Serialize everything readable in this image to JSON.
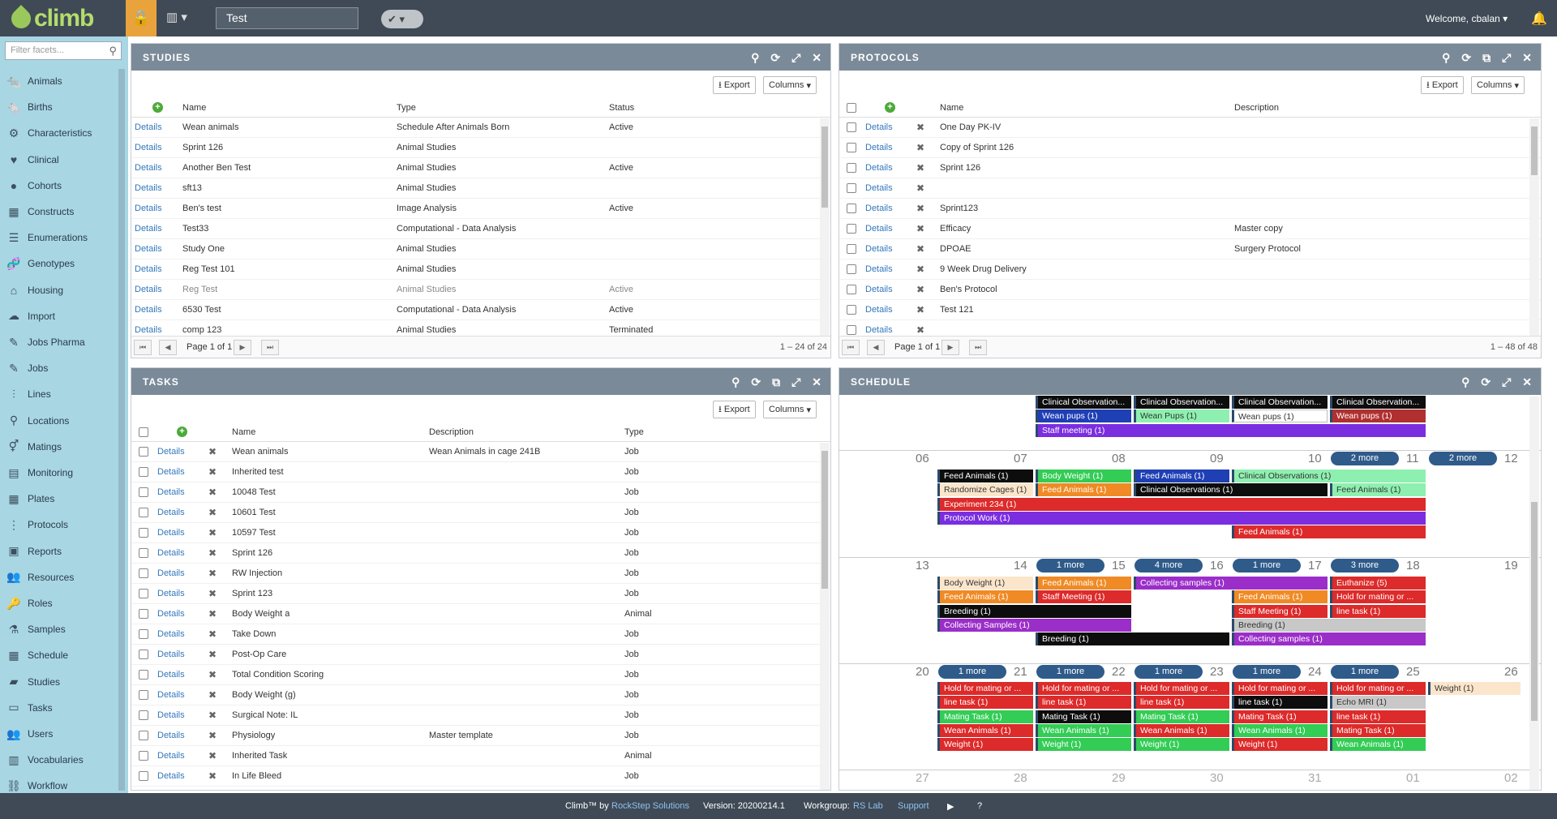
{
  "app": {
    "logo": "climb",
    "workspace_name": "Test",
    "welcome": "Welcome, cbalan"
  },
  "sidebar": {
    "filter_placeholder": "Filter facets...",
    "items": [
      {
        "label": "Animals",
        "icon": "rat-icon"
      },
      {
        "label": "Births",
        "icon": "baby-rat-icon"
      },
      {
        "label": "Characteristics",
        "icon": "cogs-icon"
      },
      {
        "label": "Clinical",
        "icon": "heartbeat-icon"
      },
      {
        "label": "Cohorts",
        "icon": "cohort-icon"
      },
      {
        "label": "Constructs",
        "icon": "grid-icon"
      },
      {
        "label": "Enumerations",
        "icon": "list-icon"
      },
      {
        "label": "Genotypes",
        "icon": "dna-icon"
      },
      {
        "label": "Housing",
        "icon": "home-icon"
      },
      {
        "label": "Import",
        "icon": "cloud-upload-icon"
      },
      {
        "label": "Jobs Pharma",
        "icon": "pipette-icon"
      },
      {
        "label": "Jobs",
        "icon": "pipette-icon"
      },
      {
        "label": "Lines",
        "icon": "lines-icon"
      },
      {
        "label": "Locations",
        "icon": "map-marker-icon"
      },
      {
        "label": "Matings",
        "icon": "mating-icon"
      },
      {
        "label": "Monitoring",
        "icon": "monitor-icon"
      },
      {
        "label": "Plates",
        "icon": "plate-grid-icon"
      },
      {
        "label": "Protocols",
        "icon": "protocol-icon"
      },
      {
        "label": "Reports",
        "icon": "report-icon"
      },
      {
        "label": "Resources",
        "icon": "users-icon"
      },
      {
        "label": "Roles",
        "icon": "key-icon"
      },
      {
        "label": "Samples",
        "icon": "test-tube-icon"
      },
      {
        "label": "Schedule",
        "icon": "calendar-icon"
      },
      {
        "label": "Studies",
        "icon": "book-icon"
      },
      {
        "label": "Tasks",
        "icon": "clipboard-icon"
      },
      {
        "label": "Users",
        "icon": "users-icon"
      },
      {
        "label": "Vocabularies",
        "icon": "library-icon"
      },
      {
        "label": "Workflow",
        "icon": "workflow-icon"
      }
    ]
  },
  "common": {
    "export": "Export",
    "columns": "Columns",
    "details": "Details",
    "page_label": "Page 1 of 1"
  },
  "studies": {
    "title": "STUDIES",
    "headers": {
      "name": "Name",
      "type": "Type",
      "status": "Status"
    },
    "rows": [
      {
        "name": "Wean animals",
        "type": "Schedule After Animals Born",
        "status": "Active"
      },
      {
        "name": "Sprint 126",
        "type": "Animal Studies",
        "status": ""
      },
      {
        "name": "Another Ben Test",
        "type": "Animal Studies",
        "status": "Active"
      },
      {
        "name": "sft13",
        "type": "Animal Studies",
        "status": ""
      },
      {
        "name": "Ben's test",
        "type": "Image Analysis",
        "status": "Active"
      },
      {
        "name": "Test33",
        "type": "Computational - Data Analysis",
        "status": ""
      },
      {
        "name": "Study One",
        "type": "Animal Studies",
        "status": ""
      },
      {
        "name": "Reg Test 101",
        "type": "Animal Studies",
        "status": ""
      },
      {
        "name": "Reg Test",
        "type": "Animal Studies",
        "status": "Active"
      },
      {
        "name": "6530 Test",
        "type": "Computational - Data Analysis",
        "status": "Active"
      },
      {
        "name": "comp 123",
        "type": "Animal Studies",
        "status": "Terminated"
      }
    ],
    "count": "1 – 24 of 24"
  },
  "protocols": {
    "title": "PROTOCOLS",
    "headers": {
      "name": "Name",
      "description": "Description"
    },
    "rows": [
      {
        "name": "One Day PK-IV",
        "description": ""
      },
      {
        "name": "Copy of Sprint 126",
        "description": ""
      },
      {
        "name": "Sprint 126",
        "description": ""
      },
      {
        "name": "",
        "description": ""
      },
      {
        "name": "Sprint123",
        "description": ""
      },
      {
        "name": "Efficacy",
        "description": "Master copy"
      },
      {
        "name": "DPOAE",
        "description": "Surgery Protocol"
      },
      {
        "name": "9 Week Drug Delivery",
        "description": ""
      },
      {
        "name": "Ben's Protocol",
        "description": ""
      },
      {
        "name": "Test 121",
        "description": ""
      },
      {
        "name": "",
        "description": ""
      }
    ],
    "count": "1 – 48 of 48"
  },
  "tasks": {
    "title": "TASKS",
    "headers": {
      "name": "Name",
      "description": "Description",
      "type": "Type"
    },
    "rows": [
      {
        "name": "Wean animals",
        "description": "Wean Animals in cage 241B",
        "type": "Job"
      },
      {
        "name": "Inherited test",
        "description": "",
        "type": "Job"
      },
      {
        "name": "10048 Test",
        "description": "",
        "type": "Job"
      },
      {
        "name": "10601 Test",
        "description": "",
        "type": "Job"
      },
      {
        "name": "10597 Test",
        "description": "",
        "type": "Job"
      },
      {
        "name": "Sprint 126",
        "description": "",
        "type": "Job"
      },
      {
        "name": "RW Injection",
        "description": "",
        "type": "Job"
      },
      {
        "name": "Sprint 123",
        "description": "",
        "type": "Job"
      },
      {
        "name": "Body Weight a",
        "description": "",
        "type": "Animal"
      },
      {
        "name": "Take Down",
        "description": "",
        "type": "Job"
      },
      {
        "name": "Post-Op Care",
        "description": "",
        "type": "Job"
      },
      {
        "name": "Total Condition Scoring",
        "description": "",
        "type": "Job"
      },
      {
        "name": "Body Weight (g)",
        "description": "",
        "type": "Job"
      },
      {
        "name": "Surgical Note: IL",
        "description": "",
        "type": "Job"
      },
      {
        "name": "Physiology",
        "description": "Master template",
        "type": "Job"
      },
      {
        "name": "Inherited Task",
        "description": "",
        "type": "Animal"
      },
      {
        "name": "In Life Bleed",
        "description": "",
        "type": "Job"
      }
    ]
  },
  "schedule": {
    "title": "SCHEDULE",
    "day_numbers": {
      "w2": [
        "06",
        "07",
        "08",
        "09",
        "10",
        "11",
        "12"
      ],
      "w3": [
        "13",
        "14",
        "15",
        "16",
        "17",
        "18",
        "19"
      ],
      "w4": [
        "20",
        "21",
        "22",
        "23",
        "24",
        "25",
        "26"
      ],
      "w5": [
        "27",
        "28",
        "29",
        "30",
        "31",
        "01",
        "02"
      ]
    },
    "more_w2": [
      "2 more",
      "2 more"
    ],
    "more_w3": [
      "1 more",
      "4 more",
      "1 more",
      "3 more"
    ],
    "more_w4": [
      "1 more",
      "1 more",
      "1 more",
      "1 more",
      "1 more"
    ],
    "events": {
      "w1": [
        "Clinical Observation...",
        "Clinical Observation...",
        "Clinical Observation...",
        "Clinical Observation...",
        "Wean pups (1)",
        "Wean Pups (1)",
        "Wean pups (1)",
        "Wean pups (1)",
        "Staff meeting (1)"
      ],
      "w2": [
        "Feed Animals (1)",
        "Body Weight (1)",
        "Feed Animals (1)",
        "Clinical Observations (1)",
        "Randomize Cages (1)",
        "Feed Animals (1)",
        "Clinical Observations (1)",
        "Feed Animals (1)",
        "Experiment 234 (1)",
        "Protocol Work (1)",
        "Feed Animals (1)"
      ],
      "w3": [
        "Body Weight (1)",
        "Feed Animals (1)",
        "Collecting samples (1)",
        "Euthanize (5)",
        "Feed Animals (1)",
        "Staff Meeting (1)",
        "Feed Animals (1)",
        "Hold for mating or ...",
        "Breeding (1)",
        "Staff Meeting (1)",
        "line task (1)",
        "Collecting Samples (1)",
        "Breeding (1)",
        "Breeding (1)",
        "Collecting samples (1)"
      ],
      "w4": [
        "Hold for mating or ...",
        "Hold for mating or ...",
        "Hold for mating or ...",
        "Hold for mating or ...",
        "Hold for mating or ...",
        "Weight (1)",
        "line task (1)",
        "line task (1)",
        "line task (1)",
        "line task (1)",
        "Echo MRI (1)",
        "Mating Task (1)",
        "Mating Task (1)",
        "Mating Task (1)",
        "Mating Task (1)",
        "line task (1)",
        "Wean Animals (1)",
        "Wean Animals (1)",
        "Wean Animals (1)",
        "Wean Animals (1)",
        "Mating Task (1)",
        "Weight (1)",
        "Weight (1)",
        "Weight (1)",
        "Weight (1)",
        "Wean Animals (1)"
      ]
    }
  },
  "footer": {
    "brand": "Climb™ by",
    "company": "RockStep Solutions",
    "version": "Version: 20200214.1",
    "workgroup_label": "Workgroup:",
    "workgroup": "RS Lab",
    "support": "Support"
  }
}
